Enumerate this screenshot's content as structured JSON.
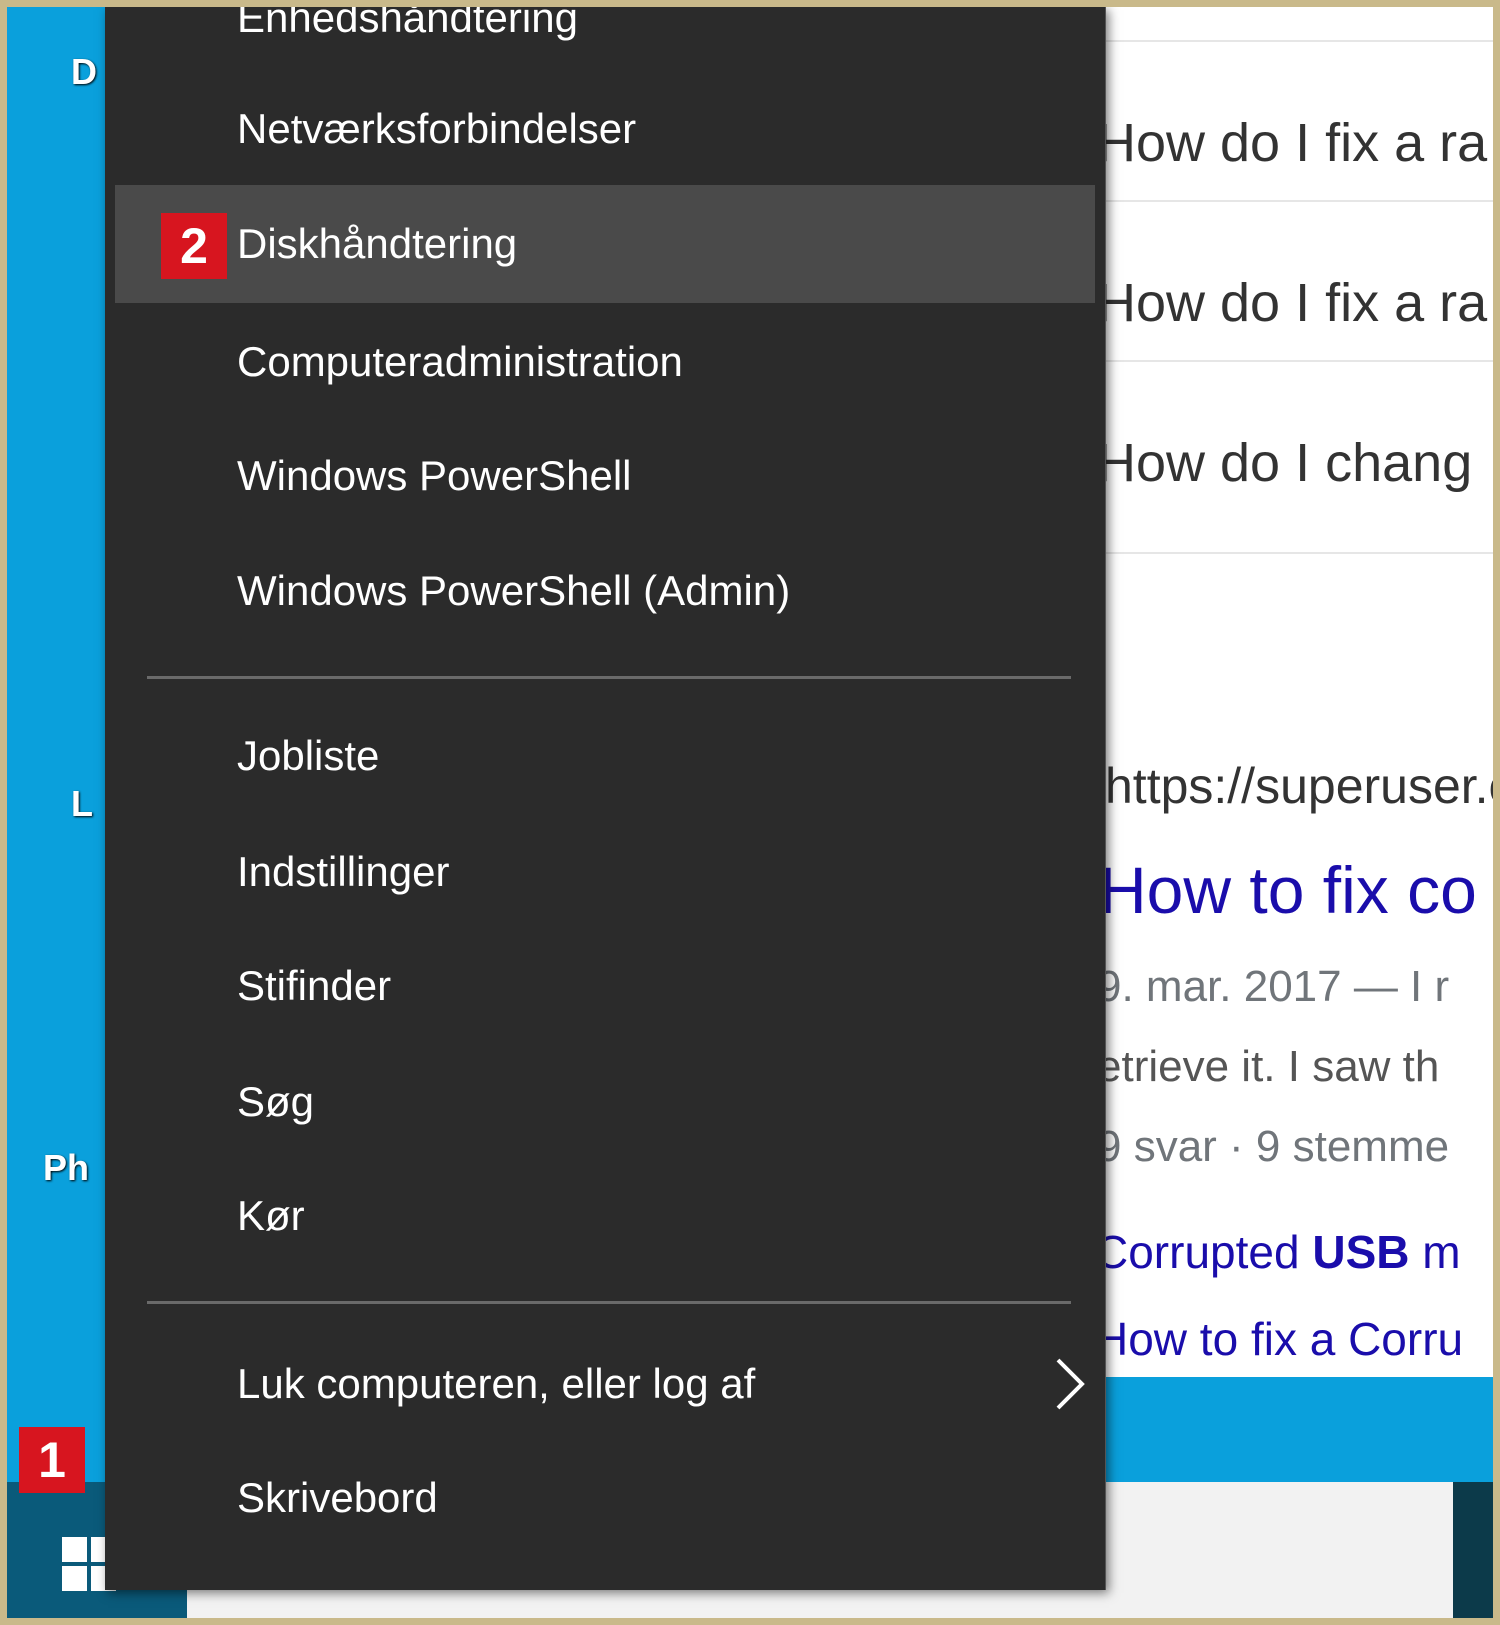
{
  "desktop": {
    "icon_label_1": "D",
    "icon_label_2": "L",
    "icon_label_3": "Ph"
  },
  "browser": {
    "questions": [
      "How do I fix a ra",
      "How do I fix a ra",
      "How do I chang"
    ],
    "url": "https://superuser.c",
    "result_title": "How to fix co",
    "result_date": "9. mar. 2017 — I r",
    "result_snippet": "etrieve it. I saw th",
    "result_meta": "9 svar · 9 stemme",
    "related_1_prefix": "Corrupted ",
    "related_1_bold": "USB",
    "related_1_suffix": " m",
    "related_2": "How to fix a Corru"
  },
  "menu": {
    "items": [
      {
        "label": "Enhedshåndtering"
      },
      {
        "label": "Netværksforbindelser"
      },
      {
        "label": "Diskhåndtering"
      },
      {
        "label": "Computeradministration"
      },
      {
        "label": "Windows PowerShell"
      },
      {
        "label": "Windows PowerShell (Admin)"
      },
      {
        "label": "Jobliste"
      },
      {
        "label": "Indstillinger"
      },
      {
        "label": "Stifinder"
      },
      {
        "label": "Søg"
      },
      {
        "label": "Kør"
      },
      {
        "label": "Luk computeren, eller log af"
      },
      {
        "label": "Skrivebord"
      }
    ]
  },
  "badges": {
    "start": "1",
    "disk": "2"
  },
  "colors": {
    "menu_bg": "#2b2b2b",
    "highlight": "#4a4a4a",
    "badge": "#d7151f",
    "desktop": "#0aa0dc",
    "link": "#1a0dab"
  },
  "icons": {
    "start": "windows-logo-icon",
    "submenu": "chevron-right-icon"
  }
}
